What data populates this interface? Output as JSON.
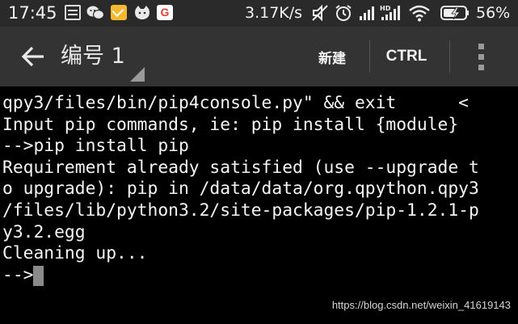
{
  "status_bar": {
    "time": "17:45",
    "network_speed": "3.17K/s",
    "battery_percent": "56%",
    "notification_icons": [
      "message-icon",
      "wechat-icon",
      "mail-icon",
      "cat-icon",
      "google-icon"
    ],
    "google_glyph": "G",
    "system_icons": [
      "mute-icon",
      "alarm-icon",
      "signal-icon",
      "hd-signal-icon",
      "wifi-icon",
      "battery-charging-icon"
    ]
  },
  "action_bar": {
    "title": "编号 1",
    "new_label": "新建",
    "ctrl_label": "CTRL",
    "back_icon": "arrow-left-icon",
    "overflow_icon": "more-vertical-icon"
  },
  "terminal": {
    "lines": [
      "qpy3/files/bin/pip4console.py\" && exit      <",
      "Input pip commands, ie: pip install {module}",
      "-->pip install pip",
      "Requirement already satisfied (use --upgrade t",
      "o upgrade): pip in /data/data/org.qpython.qpy3",
      "/files/lib/python3.2/site-packages/pip-1.2.1-p",
      "y3.2.egg",
      "Cleaning up..."
    ],
    "prompt": "-->"
  },
  "watermark": "https://blog.csdn.net/weixin_41619143",
  "colors": {
    "status_bar_bg": "#2a2a2a",
    "action_bar_bg": "#333333",
    "terminal_bg": "#000000",
    "terminal_fg": "#f5f5f5",
    "cursor": "#8a8a8a"
  }
}
